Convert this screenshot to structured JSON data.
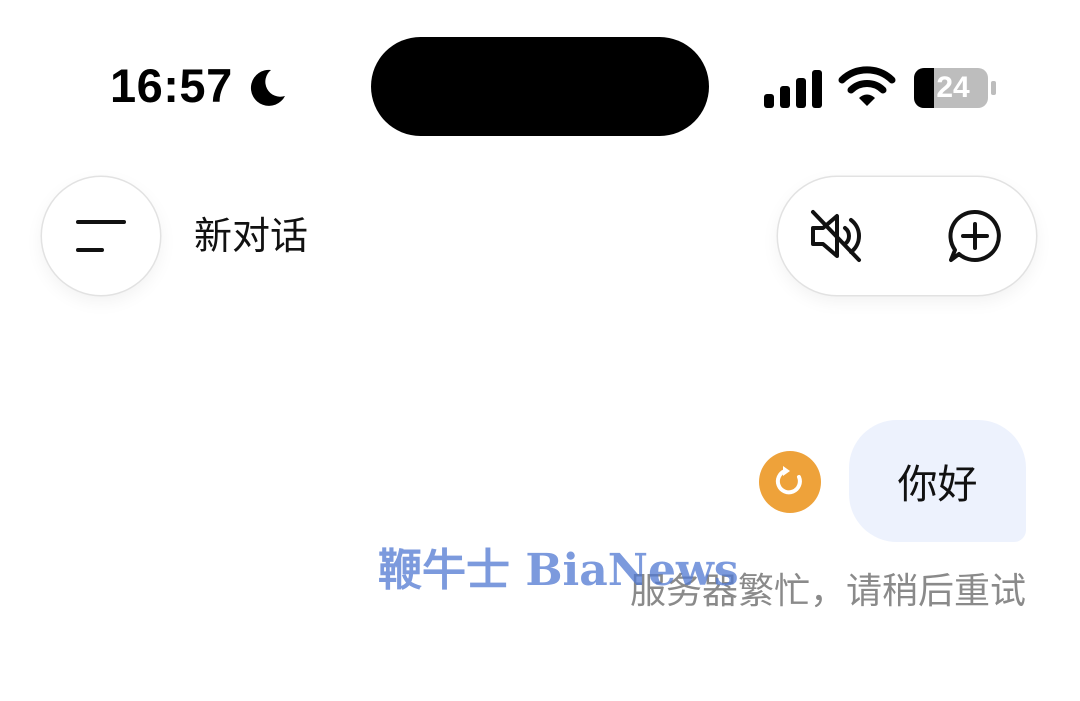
{
  "status_bar": {
    "time": "16:57",
    "moon_icon": "moon-icon",
    "signal_icon": "cellular-signal-icon",
    "wifi_icon": "wifi-icon",
    "battery_icon": "battery-icon",
    "battery_level": "24"
  },
  "header": {
    "menu_icon": "menu-icon",
    "title": "新对话",
    "mute_icon": "speaker-muted-icon",
    "new_chat_icon": "new-chat-plus-icon"
  },
  "conversation": {
    "messages": [
      {
        "role": "user",
        "text": "你好"
      }
    ],
    "retry_icon": "retry-icon",
    "retry_color": "#eea23a",
    "error_text": "服务器繁忙，请稍后重试"
  },
  "watermark": {
    "text": "鞭牛士 BiaNews"
  },
  "colors": {
    "user_bubble": "#edf2fd",
    "error_text": "#8a8a8a",
    "watermark": "#5078d2"
  }
}
